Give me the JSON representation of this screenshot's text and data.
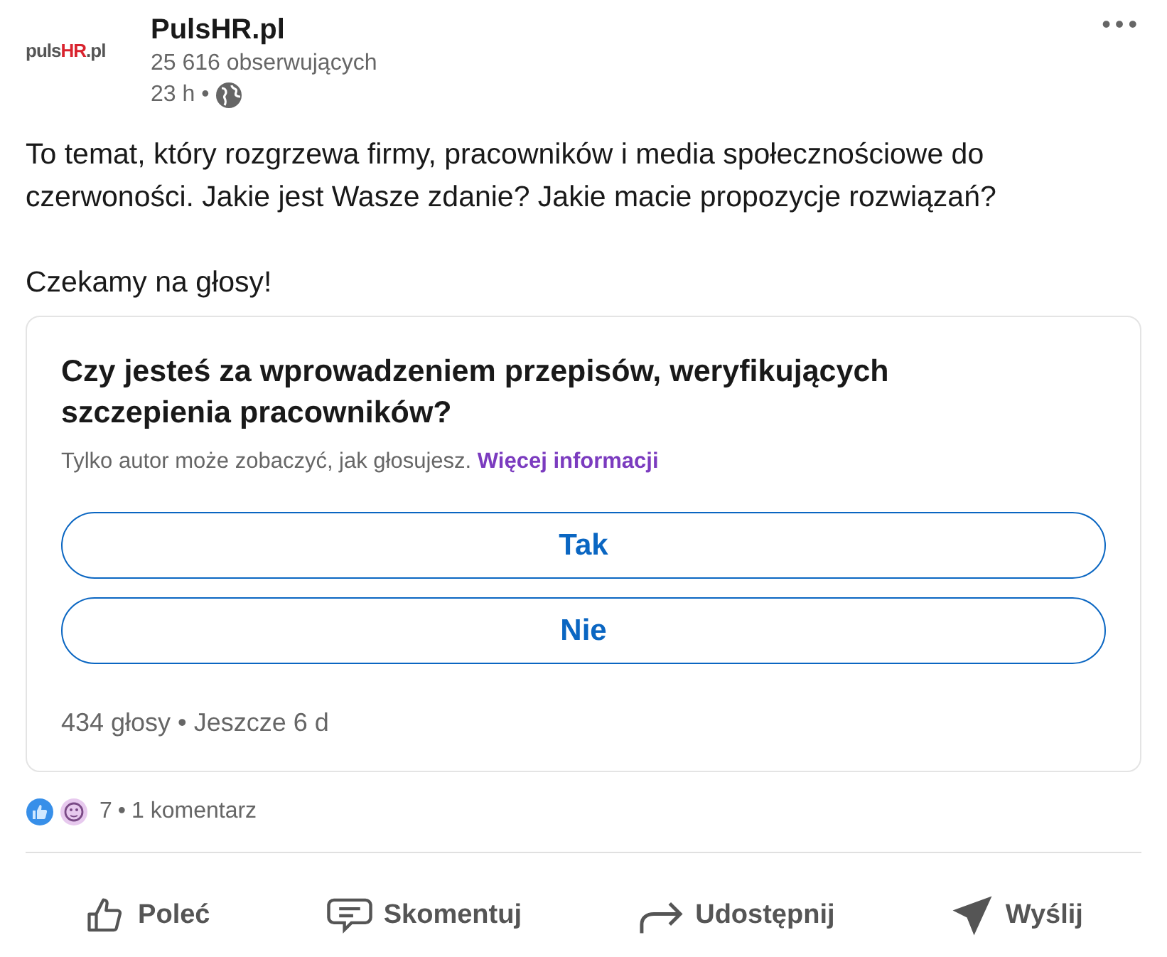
{
  "author": {
    "logo": [
      {
        "text": "puls",
        "color": "#555555"
      },
      {
        "text": "HR",
        "color": "#d9232e"
      },
      {
        "text": ".pl",
        "color": "#555555"
      }
    ],
    "name": "PulsHR.pl",
    "followers": "25 616 obserwujących",
    "time": "23 h •"
  },
  "menu": "•••",
  "post_text": [
    "To temat, który rozgrzewa firmy, pracowników i media społecznościowe do czerwoności. Jakie jest Wasze zdanie? Jakie macie propozycje rozwiązań?",
    "Czekamy na głosy!"
  ],
  "poll": {
    "question": "Czy jesteś za wprowadzeniem przepisów, weryfikujących szczepienia pracowników?",
    "note": "Tylko autor może zobaczyć, jak głosujesz.",
    "note_link": "Więcej informacji",
    "options": [
      "Tak",
      "Nie"
    ],
    "footer": "434 głosy • Jeszcze 6 d"
  },
  "social": {
    "reactions": "7",
    "separator": "•",
    "comments": "1 komentarz"
  },
  "actions": [
    {
      "kind": "like",
      "label": "Poleć"
    },
    {
      "kind": "comment",
      "label": "Skomentuj"
    },
    {
      "kind": "share",
      "label": "Udostępnij"
    },
    {
      "kind": "send",
      "label": "Wyślij"
    }
  ]
}
